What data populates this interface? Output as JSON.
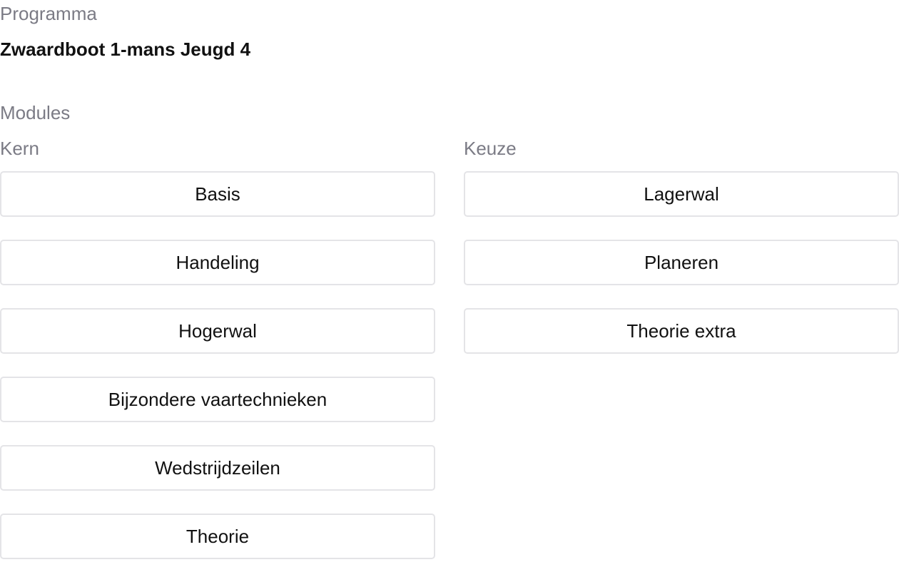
{
  "program": {
    "label": "Programma",
    "name": "Zwaardboot 1-mans Jeugd 4"
  },
  "modules": {
    "label": "Modules",
    "kern": {
      "label": "Kern",
      "items": [
        "Basis",
        "Handeling",
        "Hogerwal",
        "Bijzondere vaartechnieken",
        "Wedstrijdzeilen",
        "Theorie"
      ]
    },
    "keuze": {
      "label": "Keuze",
      "items": [
        "Lagerwal",
        "Planeren",
        "Theorie extra"
      ]
    }
  }
}
